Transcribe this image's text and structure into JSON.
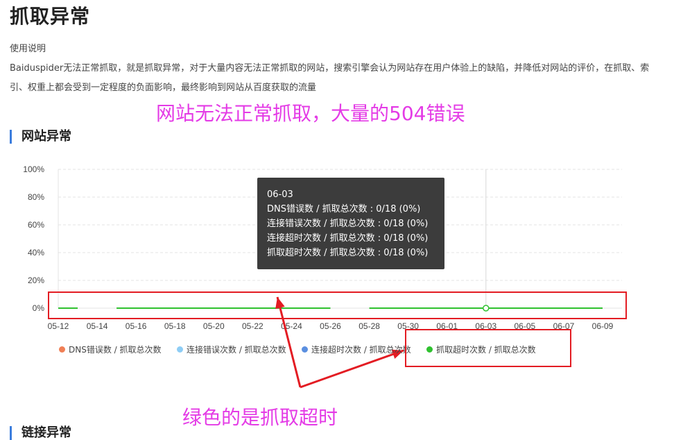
{
  "page": {
    "title": "抓取异常",
    "usage_label": "使用说明",
    "description": "Baiduspider无法正常抓取，就是抓取异常，对于大量内容无法正常抓取的网站，搜索引擎会认为网站存在用户体验上的缺陷，并降低对网站的评价，在抓取、索引、权重上都会受到一定程度的负面影响，最终影响到网站从百度获取的流量"
  },
  "annotations": {
    "top_text": "网站无法正常抓取，大量的504错误",
    "bottom_text": "绿色的是抓取超时",
    "color": "#e43be6",
    "box_color": "#e31c23"
  },
  "sections": {
    "site_error": "网站异常",
    "link_error": "链接异常"
  },
  "tooltip": {
    "date": "06-03",
    "lines": [
      "DNS错误数 / 抓取总次数 : 0/18 (0%)",
      "连接错误次数 / 抓取总次数 : 0/18 (0%)",
      "连接超时次数 / 抓取总次数 : 0/18 (0%)",
      "抓取超时次数 / 抓取总次数 : 0/18 (0%)"
    ]
  },
  "legend": [
    {
      "label": "DNS错误数 / 抓取总次数",
      "color": "#f07f55"
    },
    {
      "label": "连接错误次数 / 抓取总次数",
      "color": "#8ecdf5"
    },
    {
      "label": "连接超时次数 / 抓取总次数",
      "color": "#5b8fe0"
    },
    {
      "label": "抓取超时次数 / 抓取总次数",
      "color": "#2fc12f"
    }
  ],
  "chart_data": {
    "type": "line",
    "title": "",
    "xlabel": "",
    "ylabel": "",
    "ylim": [
      0,
      100
    ],
    "y_ticks": [
      "100%",
      "80%",
      "60%",
      "40%",
      "20%",
      "0%"
    ],
    "x_tick_labels": [
      "05-12",
      "05-14",
      "05-16",
      "05-18",
      "05-20",
      "05-22",
      "05-24",
      "05-26",
      "05-28",
      "05-30",
      "06-01",
      "06-03",
      "06-05",
      "06-07",
      "06-09"
    ],
    "x": [
      "05-12",
      "05-13",
      "05-14",
      "05-15",
      "05-16",
      "05-17",
      "05-18",
      "05-19",
      "05-20",
      "05-21",
      "05-22",
      "05-23",
      "05-24",
      "05-25",
      "05-26",
      "05-27",
      "05-28",
      "05-29",
      "05-30",
      "05-31",
      "06-01",
      "06-02",
      "06-03",
      "06-04",
      "06-05",
      "06-06",
      "06-07",
      "06-08",
      "06-09"
    ],
    "series": [
      {
        "name": "抓取超时次数 / 抓取总次数",
        "color": "#2fc12f",
        "values": [
          0,
          0,
          null,
          0,
          0,
          0,
          0,
          0,
          0,
          0,
          0,
          0,
          0,
          0,
          0,
          null,
          0,
          0,
          0,
          0,
          0,
          0,
          0,
          0,
          0,
          0,
          0,
          0,
          0
        ]
      }
    ],
    "highlighted_x": "06-03",
    "grid": true,
    "legend_position": "bottom"
  }
}
